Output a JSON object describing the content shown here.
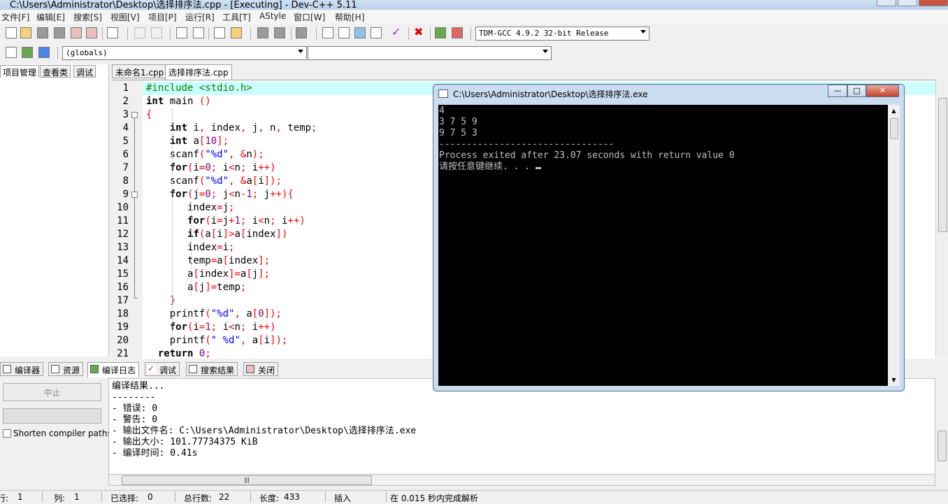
{
  "window": {
    "title": "C:\\Users\\Administrator\\Desktop\\选择排序法.cpp - [Executing] - Dev-C++ 5.11"
  },
  "menu": [
    "文件[F]",
    "编辑[E]",
    "搜索[S]",
    "视图[V]",
    "项目[P]",
    "运行[R]",
    "工具[T]",
    "AStyle",
    "窗口[W]",
    "帮助[H]"
  ],
  "toolbar": {
    "compiler_select": "TDM-GCC 4.9.2 32-bit Release",
    "scope_select": "(globals)",
    "member_select": ""
  },
  "left_tabs": [
    "项目管理",
    "查看类",
    "调试"
  ],
  "file_tabs": [
    "未命名1.cpp",
    "选择排序法.cpp"
  ],
  "editor": {
    "lines": [
      {
        "n": "1",
        "segs": [
          {
            "c": "pp",
            "t": "#include <stdio.h>"
          }
        ]
      },
      {
        "n": "2",
        "segs": [
          {
            "c": "kw",
            "t": "int"
          },
          {
            "c": "",
            "t": " main "
          },
          {
            "c": "sym",
            "t": "()"
          }
        ]
      },
      {
        "n": "3",
        "segs": [
          {
            "c": "sym",
            "t": "{"
          }
        ]
      },
      {
        "n": "4",
        "segs": [
          {
            "c": "",
            "t": "    "
          },
          {
            "c": "kw",
            "t": "int"
          },
          {
            "c": "",
            "t": " i"
          },
          {
            "c": "sym",
            "t": ","
          },
          {
            "c": "",
            "t": " index"
          },
          {
            "c": "sym",
            "t": ","
          },
          {
            "c": "",
            "t": " j"
          },
          {
            "c": "sym",
            "t": ","
          },
          {
            "c": "",
            "t": " n"
          },
          {
            "c": "sym",
            "t": ","
          },
          {
            "c": "",
            "t": " temp"
          },
          {
            "c": "sym",
            "t": ";"
          }
        ]
      },
      {
        "n": "5",
        "segs": [
          {
            "c": "",
            "t": "    "
          },
          {
            "c": "kw",
            "t": "int"
          },
          {
            "c": "",
            "t": " a"
          },
          {
            "c": "sym",
            "t": "["
          },
          {
            "c": "num",
            "t": "10"
          },
          {
            "c": "sym",
            "t": "];"
          }
        ]
      },
      {
        "n": "6",
        "segs": [
          {
            "c": "",
            "t": "    scanf"
          },
          {
            "c": "sym",
            "t": "("
          },
          {
            "c": "str",
            "t": "\"%d\""
          },
          {
            "c": "sym",
            "t": ","
          },
          {
            "c": "",
            "t": " "
          },
          {
            "c": "sym",
            "t": "&"
          },
          {
            "c": "",
            "t": "n"
          },
          {
            "c": "sym",
            "t": ");"
          }
        ]
      },
      {
        "n": "7",
        "segs": [
          {
            "c": "",
            "t": "    "
          },
          {
            "c": "kw",
            "t": "for"
          },
          {
            "c": "sym",
            "t": "("
          },
          {
            "c": "",
            "t": "i"
          },
          {
            "c": "sym",
            "t": "="
          },
          {
            "c": "num",
            "t": "0"
          },
          {
            "c": "sym",
            "t": ";"
          },
          {
            "c": "",
            "t": " i"
          },
          {
            "c": "sym",
            "t": "<"
          },
          {
            "c": "",
            "t": "n"
          },
          {
            "c": "sym",
            "t": ";"
          },
          {
            "c": "",
            "t": " i"
          },
          {
            "c": "sym",
            "t": "++)"
          }
        ]
      },
      {
        "n": "8",
        "segs": [
          {
            "c": "",
            "t": "    scanf"
          },
          {
            "c": "sym",
            "t": "("
          },
          {
            "c": "str",
            "t": "\"%d\""
          },
          {
            "c": "sym",
            "t": ","
          },
          {
            "c": "",
            "t": " "
          },
          {
            "c": "sym",
            "t": "&"
          },
          {
            "c": "",
            "t": "a"
          },
          {
            "c": "sym",
            "t": "["
          },
          {
            "c": "",
            "t": "i"
          },
          {
            "c": "sym",
            "t": "]);"
          }
        ]
      },
      {
        "n": "9",
        "segs": [
          {
            "c": "",
            "t": "    "
          },
          {
            "c": "kw",
            "t": "for"
          },
          {
            "c": "sym",
            "t": "("
          },
          {
            "c": "",
            "t": "j"
          },
          {
            "c": "sym",
            "t": "="
          },
          {
            "c": "num",
            "t": "0"
          },
          {
            "c": "sym",
            "t": ";"
          },
          {
            "c": "",
            "t": " j"
          },
          {
            "c": "sym",
            "t": "<"
          },
          {
            "c": "",
            "t": "n"
          },
          {
            "c": "sym",
            "t": "-"
          },
          {
            "c": "num",
            "t": "1"
          },
          {
            "c": "sym",
            "t": ";"
          },
          {
            "c": "",
            "t": " j"
          },
          {
            "c": "sym",
            "t": "++){"
          }
        ]
      },
      {
        "n": "10",
        "segs": [
          {
            "c": "",
            "t": "       index"
          },
          {
            "c": "sym",
            "t": "="
          },
          {
            "c": "",
            "t": "j"
          },
          {
            "c": "sym",
            "t": ";"
          }
        ]
      },
      {
        "n": "11",
        "segs": [
          {
            "c": "",
            "t": "       "
          },
          {
            "c": "kw",
            "t": "for"
          },
          {
            "c": "sym",
            "t": "("
          },
          {
            "c": "",
            "t": "i"
          },
          {
            "c": "sym",
            "t": "="
          },
          {
            "c": "",
            "t": "j"
          },
          {
            "c": "sym",
            "t": "+"
          },
          {
            "c": "num",
            "t": "1"
          },
          {
            "c": "sym",
            "t": ";"
          },
          {
            "c": "",
            "t": " i"
          },
          {
            "c": "sym",
            "t": "<"
          },
          {
            "c": "",
            "t": "n"
          },
          {
            "c": "sym",
            "t": ";"
          },
          {
            "c": "",
            "t": " i"
          },
          {
            "c": "sym",
            "t": "++)"
          }
        ]
      },
      {
        "n": "12",
        "segs": [
          {
            "c": "",
            "t": "       "
          },
          {
            "c": "kw",
            "t": "if"
          },
          {
            "c": "sym",
            "t": "("
          },
          {
            "c": "",
            "t": "a"
          },
          {
            "c": "sym",
            "t": "["
          },
          {
            "c": "",
            "t": "i"
          },
          {
            "c": "sym",
            "t": "]>"
          },
          {
            "c": "",
            "t": "a"
          },
          {
            "c": "sym",
            "t": "["
          },
          {
            "c": "",
            "t": "index"
          },
          {
            "c": "sym",
            "t": "])"
          }
        ]
      },
      {
        "n": "13",
        "segs": [
          {
            "c": "",
            "t": "       index"
          },
          {
            "c": "sym",
            "t": "="
          },
          {
            "c": "",
            "t": "i"
          },
          {
            "c": "sym",
            "t": ";"
          }
        ]
      },
      {
        "n": "14",
        "segs": [
          {
            "c": "",
            "t": "       temp"
          },
          {
            "c": "sym",
            "t": "="
          },
          {
            "c": "",
            "t": "a"
          },
          {
            "c": "sym",
            "t": "["
          },
          {
            "c": "",
            "t": "index"
          },
          {
            "c": "sym",
            "t": "];"
          }
        ]
      },
      {
        "n": "15",
        "segs": [
          {
            "c": "",
            "t": "       a"
          },
          {
            "c": "sym",
            "t": "["
          },
          {
            "c": "",
            "t": "index"
          },
          {
            "c": "sym",
            "t": "]="
          },
          {
            "c": "",
            "t": "a"
          },
          {
            "c": "sym",
            "t": "["
          },
          {
            "c": "",
            "t": "j"
          },
          {
            "c": "sym",
            "t": "];"
          }
        ]
      },
      {
        "n": "16",
        "segs": [
          {
            "c": "",
            "t": "       a"
          },
          {
            "c": "sym",
            "t": "["
          },
          {
            "c": "",
            "t": "j"
          },
          {
            "c": "sym",
            "t": "]="
          },
          {
            "c": "",
            "t": "temp"
          },
          {
            "c": "sym",
            "t": ";"
          }
        ]
      },
      {
        "n": "17",
        "segs": [
          {
            "c": "",
            "t": "    "
          },
          {
            "c": "sym",
            "t": "}"
          }
        ]
      },
      {
        "n": "18",
        "segs": [
          {
            "c": "",
            "t": "    printf"
          },
          {
            "c": "sym",
            "t": "("
          },
          {
            "c": "str",
            "t": "\"%d\""
          },
          {
            "c": "sym",
            "t": ","
          },
          {
            "c": "",
            "t": " a"
          },
          {
            "c": "sym",
            "t": "["
          },
          {
            "c": "num",
            "t": "0"
          },
          {
            "c": "sym",
            "t": "]);"
          }
        ]
      },
      {
        "n": "19",
        "segs": [
          {
            "c": "",
            "t": "    "
          },
          {
            "c": "kw",
            "t": "for"
          },
          {
            "c": "sym",
            "t": "("
          },
          {
            "c": "",
            "t": "i"
          },
          {
            "c": "sym",
            "t": "="
          },
          {
            "c": "num",
            "t": "1"
          },
          {
            "c": "sym",
            "t": ";"
          },
          {
            "c": "",
            "t": " i"
          },
          {
            "c": "sym",
            "t": "<"
          },
          {
            "c": "",
            "t": "n"
          },
          {
            "c": "sym",
            "t": ";"
          },
          {
            "c": "",
            "t": " i"
          },
          {
            "c": "sym",
            "t": "++)"
          }
        ]
      },
      {
        "n": "20",
        "segs": [
          {
            "c": "",
            "t": "    printf"
          },
          {
            "c": "sym",
            "t": "("
          },
          {
            "c": "str",
            "t": "\" %d\""
          },
          {
            "c": "sym",
            "t": ","
          },
          {
            "c": "",
            "t": " a"
          },
          {
            "c": "sym",
            "t": "["
          },
          {
            "c": "",
            "t": "i"
          },
          {
            "c": "sym",
            "t": "]);"
          }
        ]
      },
      {
        "n": "21",
        "segs": [
          {
            "c": "",
            "t": "  "
          },
          {
            "c": "kw",
            "t": "return"
          },
          {
            "c": "",
            "t": " "
          },
          {
            "c": "num",
            "t": "0"
          },
          {
            "c": "sym",
            "t": ";"
          }
        ]
      }
    ]
  },
  "bottom_tabs": [
    "编译器",
    "资源",
    "编译日志",
    "调试",
    "搜索结果",
    "关闭"
  ],
  "compile_panel": {
    "abort_label": "中止",
    "shorten_label": "Shorten compiler paths",
    "log": [
      "编译结果...",
      "--------",
      "- 错误: 0",
      "- 警告: 0",
      "- 输出文件名: C:\\Users\\Administrator\\Desktop\\选择排序法.exe",
      "- 输出大小: 101.77734375 KiB",
      "- 编译时间: 0.41s"
    ]
  },
  "statusbar": {
    "row_label": "行:",
    "row_value": "1",
    "col_label": "列:",
    "col_value": "1",
    "sel_label": "已选择:",
    "sel_value": "0",
    "lines_label": "总行数:",
    "lines_value": "22",
    "len_label": "长度:",
    "len_value": "433",
    "mode": "插入",
    "parse": "在 0.015 秒内完成解析"
  },
  "console": {
    "title": "C:\\Users\\Administrator\\Desktop\\选择排序法.exe",
    "lines": [
      "4",
      "3 7 5 9",
      "9 7 5 3",
      "--------------------------------",
      "Process exited after 23.07 seconds with return value 0",
      "请按任意键继续. . . "
    ]
  }
}
